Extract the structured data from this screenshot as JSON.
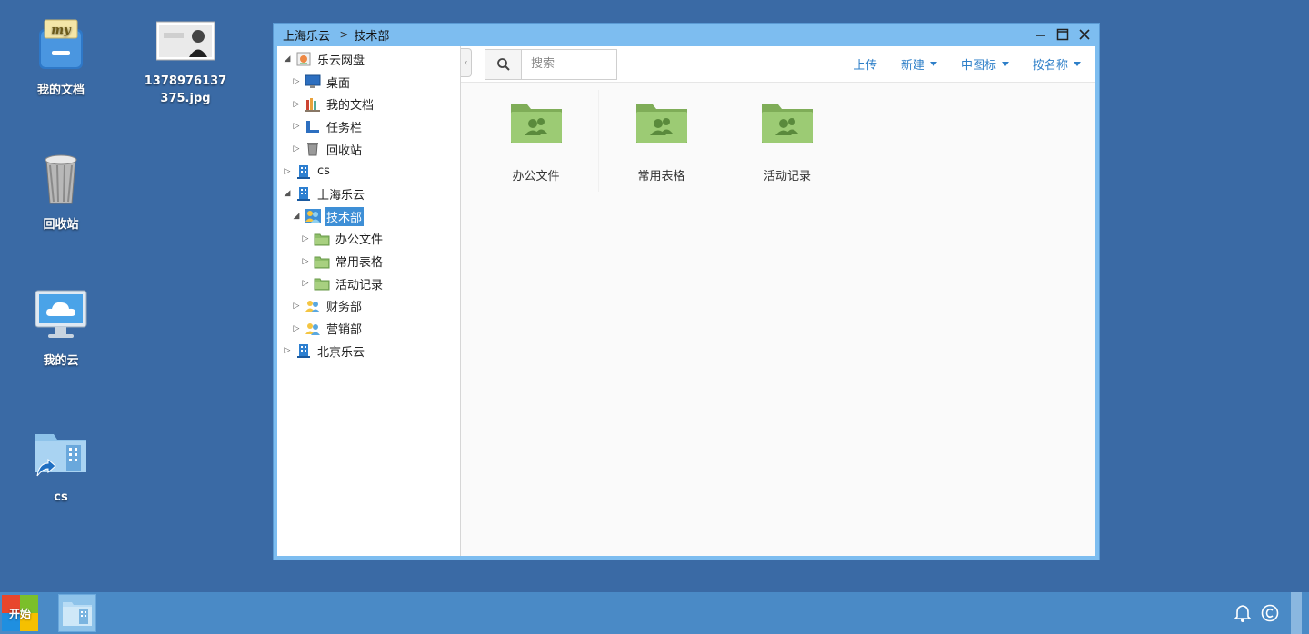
{
  "desktop": {
    "icons": [
      {
        "label": "我的文档",
        "icon": "my-documents-icon"
      },
      {
        "label": "1378976137\n375.jpg",
        "icon": "image-file-icon"
      },
      {
        "label": "回收站",
        "icon": "recycle-bin-icon"
      },
      {
        "label": "我的云",
        "icon": "my-cloud-icon"
      },
      {
        "label": "cs",
        "icon": "cs-shortcut-icon"
      }
    ],
    "image_label_line1": "1378976137",
    "image_label_line2": "375.jpg"
  },
  "window": {
    "path_root": "上海乐云",
    "path_sep": "->",
    "path_current": "技术部"
  },
  "tree": [
    {
      "label": "乐云网盘",
      "expanded": true
    },
    {
      "label": "桌面"
    },
    {
      "label": "我的文档"
    },
    {
      "label": "任务栏"
    },
    {
      "label": "回收站"
    },
    {
      "label": "cs"
    },
    {
      "label": "上海乐云",
      "expanded": true
    },
    {
      "label": "技术部",
      "selected": true,
      "expanded": true
    },
    {
      "label": "办公文件"
    },
    {
      "label": "常用表格"
    },
    {
      "label": "活动记录"
    },
    {
      "label": "财务部"
    },
    {
      "label": "营销部"
    },
    {
      "label": "北京乐云"
    }
  ],
  "toolbar": {
    "search_placeholder": "搜索",
    "upload": "上传",
    "new": "新建",
    "view": "中图标",
    "sort": "按名称"
  },
  "files": [
    {
      "name": "办公文件"
    },
    {
      "name": "常用表格"
    },
    {
      "name": "活动记录"
    }
  ],
  "taskbar": {
    "start_label": "开始"
  },
  "colors": {
    "desktop_bg": "#3a6aa5",
    "window_frame": "#7dbdf0",
    "accent": "#2e7fc8",
    "selection": "#3e8fd6",
    "folder_green": "#8fbf6a"
  }
}
